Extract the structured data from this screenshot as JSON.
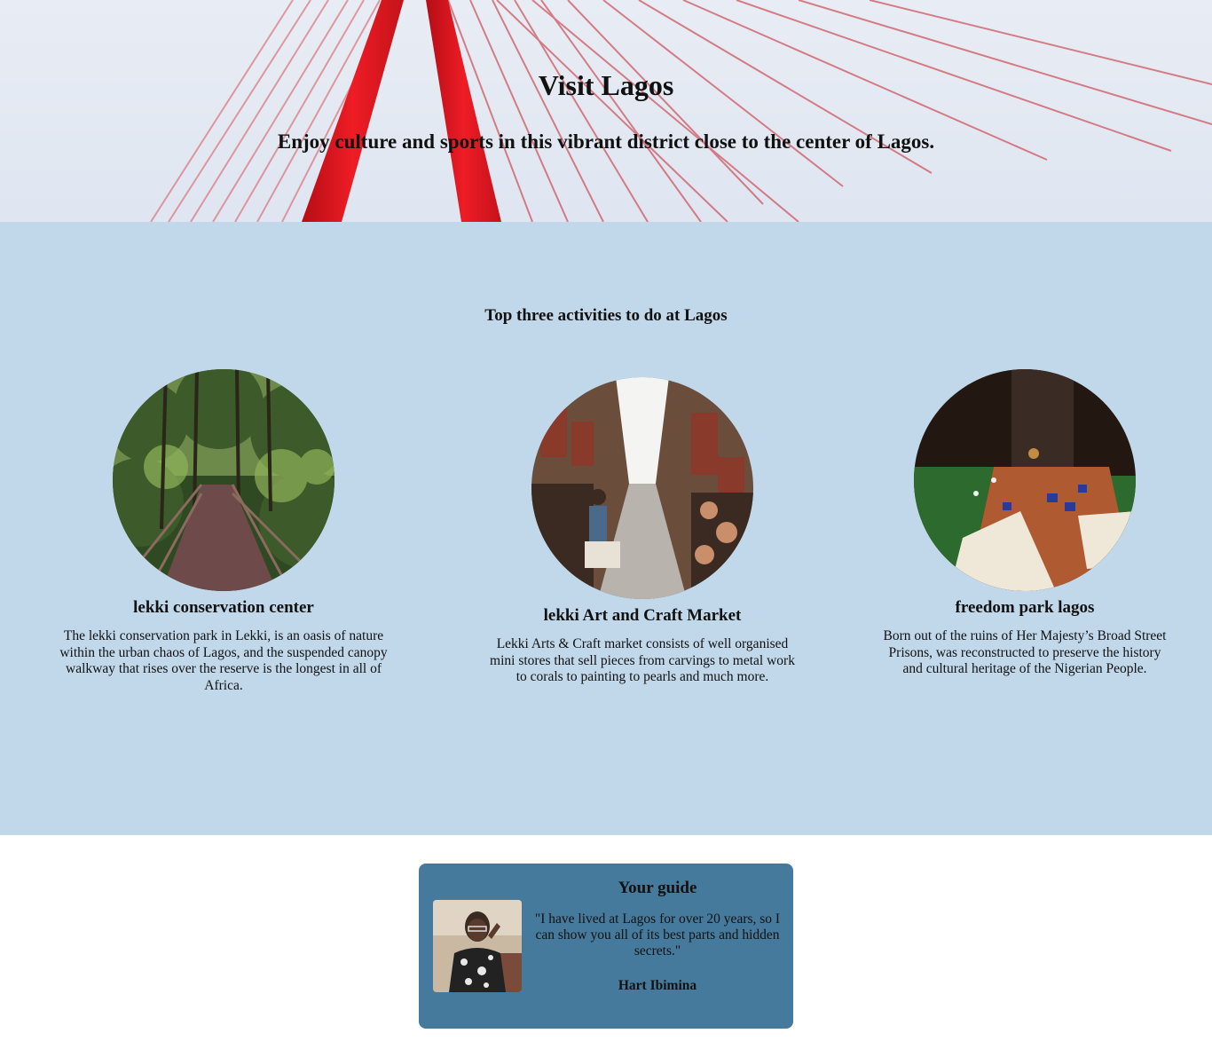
{
  "hero": {
    "title": "Visit Lagos",
    "subtitle": "Enjoy culture and sports in this vibrant district close to the center of Lagos."
  },
  "activities": {
    "heading": "Top three activities to do at Lagos",
    "items": [
      {
        "title": "lekki conservation center",
        "description": "The lekki conservation park in Lekki, is an oasis of nature within the urban chaos of Lagos, and the suspended canopy walkway that rises over the reserve is the longest in all of Africa."
      },
      {
        "title": "lekki Art and Craft Market",
        "description": "Lekki Arts & Craft market consists of well organised mini stores that sell pieces from carvings to metal work to corals to painting to pearls and much more."
      },
      {
        "title": "freedom park lagos",
        "description": "Born out of the ruins of Her Majesty’s Broad Street Prisons, was reconstructed to preserve the history and cultural heritage of the Nigerian People."
      }
    ]
  },
  "guide": {
    "title": "Your guide",
    "quote": "\"I have lived at Lagos for over 20 years, so I can show you all of its best parts and hidden secrets.\"",
    "name": "Hart Ibimina"
  },
  "colors": {
    "activities_bg": "#c1d8ea",
    "guide_card_bg": "#467a9c",
    "hero_accent": "#e3151f"
  }
}
